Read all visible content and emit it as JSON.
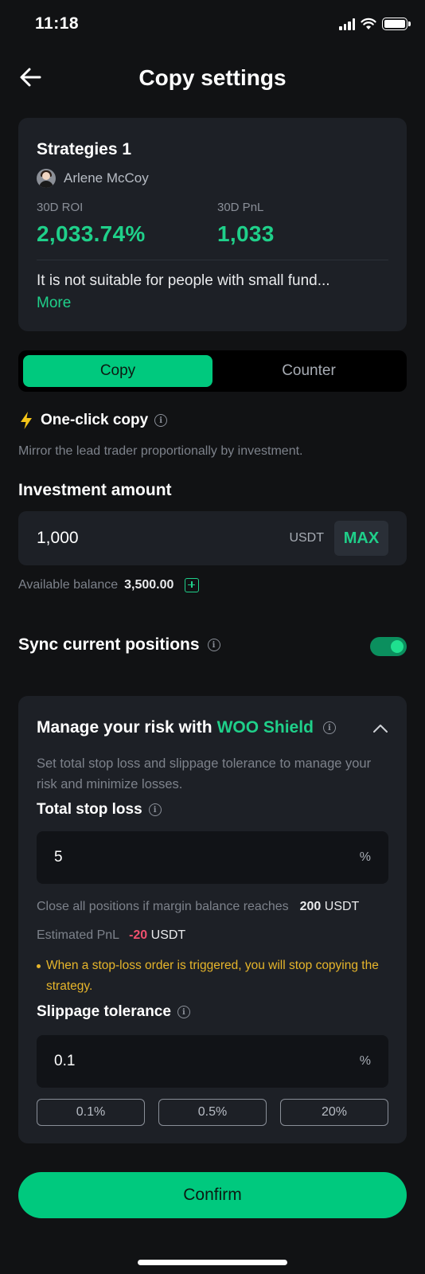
{
  "status_bar": {
    "time": "11:18"
  },
  "header": {
    "title": "Copy settings"
  },
  "strategy": {
    "name": "Strategies 1",
    "trader": "Arlene McCoy",
    "roi_label": "30D ROI",
    "roi_value": "2,033.74%",
    "pnl_label": "30D PnL",
    "pnl_value": "1,033",
    "description": "It is not suitable for people with small fund...",
    "more_label": "More"
  },
  "tabs": [
    {
      "label": "Copy",
      "active": true
    },
    {
      "label": "Counter",
      "active": false
    }
  ],
  "one_click": {
    "label": "One-click copy",
    "description": "Mirror the lead trader proportionally by investment."
  },
  "investment": {
    "title": "Investment amount",
    "value": "1,000",
    "unit": "USDT",
    "max_label": "MAX",
    "balance_label": "Available balance",
    "balance_value": "3,500.00"
  },
  "sync": {
    "label": "Sync current positions",
    "enabled": true
  },
  "risk": {
    "title_prefix": "Manage your risk with",
    "title_highlight": "WOO Shield",
    "description": "Set total stop loss and slippage tolerance to manage your risk and minimize losses.",
    "stop_loss_label": "Total stop loss",
    "stop_loss_value": "5",
    "stop_loss_unit": "%",
    "close_label": "Close all positions if margin balance reaches",
    "close_value": "200",
    "close_unit": "USDT",
    "est_pnl_label": "Estimated PnL",
    "est_pnl_value": "-20",
    "est_pnl_unit": "USDT",
    "warning": "When a stop-loss order is triggered, you will stop copying the strategy.",
    "slippage_label": "Slippage tolerance",
    "slippage_value": "0.1",
    "slippage_unit": "%",
    "presets": [
      "0.1%",
      "0.5%",
      "20%"
    ]
  },
  "confirm_label": "Confirm",
  "colors": {
    "background": "#111214",
    "card": "#1d2026",
    "accent": "#00c97e",
    "positive": "#1fd08a",
    "negative": "#f0506e",
    "warning": "#e6b52b"
  }
}
